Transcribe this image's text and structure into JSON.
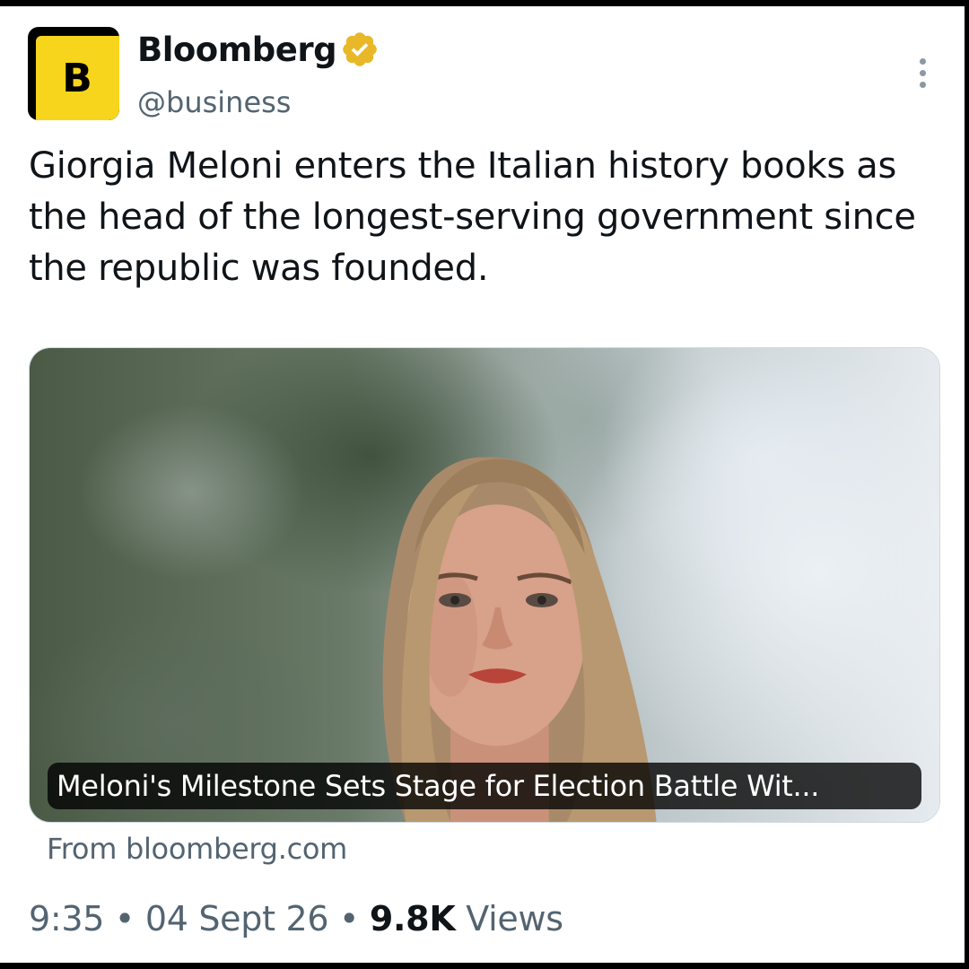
{
  "account": {
    "avatar_letter": "B",
    "avatar_color": "#f7d51d",
    "name": "Bloomberg",
    "handle": "@business",
    "verified_badge_color": "#e8b828",
    "verified_icon": "gold-verified-badge-icon"
  },
  "menu_icon": "more-vertical-icon",
  "tweet": {
    "text": "Giorgia Meloni enters the Italian history books as the head of the longest-serving government since the republic was founded."
  },
  "link_card": {
    "title": "Meloni's Milestone Sets Stage for Election Battle Wit...",
    "source": "From bloomberg.com"
  },
  "meta": {
    "time": "9:35",
    "separator": "•",
    "date": "04 Sept 26",
    "views_count": "9.8K",
    "views_label": "Views"
  }
}
